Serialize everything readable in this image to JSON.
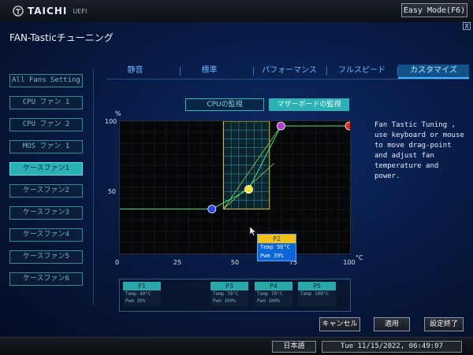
{
  "brand": {
    "name": "TAICHI",
    "sub": "UEFI"
  },
  "topbar": {
    "easy_mode_label": "Easy Mode(F6)"
  },
  "page": {
    "title": "FAN-Tasticチューニング",
    "close": "X"
  },
  "sidebar": {
    "items": [
      {
        "label": "All Fans Setting",
        "active": false
      },
      {
        "label": "CPU ファン 1",
        "active": false
      },
      {
        "label": "CPU ファン 2",
        "active": false
      },
      {
        "label": "MOS ファン 1",
        "active": false
      },
      {
        "label": "ケースファン1",
        "active": true
      },
      {
        "label": "ケースファン2",
        "active": false
      },
      {
        "label": "ケースファン3",
        "active": false
      },
      {
        "label": "ケースファン4",
        "active": false
      },
      {
        "label": "ケースファン5",
        "active": false
      },
      {
        "label": "ケースファン6",
        "active": false
      }
    ]
  },
  "tabs": [
    {
      "label": "静音",
      "active": false
    },
    {
      "label": "標準",
      "active": false
    },
    {
      "label": "パフォーマンス",
      "active": false
    },
    {
      "label": "フルスピード",
      "active": false
    },
    {
      "label": "カスタマイズ",
      "active": true
    }
  ],
  "monitor": {
    "cpu_label": "CPUの監視",
    "mb_label": "マザーボードの監視"
  },
  "chart_data": {
    "type": "line",
    "xlabel": "°C",
    "ylabel": "%",
    "xlim": [
      0,
      100
    ],
    "ylim": [
      0,
      100
    ],
    "x_ticks": [
      "0",
      "25",
      "50",
      "75",
      "100"
    ],
    "y_ticks": [
      "50",
      "100"
    ],
    "curve": [
      {
        "name": "P1",
        "x": 40,
        "y": 20,
        "color": "#2a46e8"
      },
      {
        "name": "P2",
        "x": 56,
        "y": 39,
        "color": "#f2e23a"
      },
      {
        "name": "P3",
        "x": 70,
        "y": 100,
        "color": "#b13ad8"
      },
      {
        "name": "P5",
        "x": 100,
        "y": 100,
        "color": "#e8281c"
      }
    ],
    "guide_lines": [
      {
        "x1": 45,
        "y1": 20,
        "x2": 67,
        "y2": 64
      },
      {
        "x1": 45,
        "y1": 20,
        "x2": 70,
        "y2": 100
      }
    ],
    "drag_zone": {
      "x_from": 45,
      "x_to": 65
    },
    "grid": true
  },
  "tooltip": {
    "title": "P2",
    "temp": "Temp 56°C",
    "pwm": "Pwm  39%"
  },
  "help": {
    "text": "Fan Tastic Tuning , use keyboard or mouse to move drag-point and adjust fan temperature and power."
  },
  "points": [
    {
      "name": "P1",
      "temp": "Temp 40°C",
      "pwm": "Pwm  20%"
    },
    {
      "name": "P3",
      "temp": "Temp 70°C",
      "pwm": "Pwm  100%"
    },
    {
      "name": "P4",
      "temp": "Temp 70°C",
      "pwm": "Pwm  100%"
    },
    {
      "name": "P5",
      "temp": "Temp 100°C",
      "pwm": ""
    }
  ],
  "buttons": {
    "cancel": "キャンセル",
    "apply": "適用",
    "finish": "設定終了"
  },
  "status": {
    "language": "日本語",
    "datetime": "Tue 11/15/2022, 06:49:07"
  }
}
